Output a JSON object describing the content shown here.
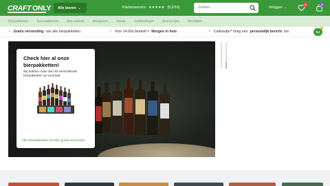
{
  "header": {
    "logo_part1": "CRAFT",
    "logo_part2": "ONLY",
    "menu_button": "Alle bieren",
    "customer_service": "Klantenservice",
    "stars": "★★★★★",
    "rating": "(9,2/10)",
    "search_placeholder": "Zoeken...",
    "login": "Inloggen",
    "wishlist_count": "0",
    "cart_count": "0"
  },
  "categories": [
    "Bierpakketten",
    "Speciaalbieren",
    "Bier cadeau",
    "Bierglazen",
    "Nieuw",
    "Aanbiedingen",
    "Brouwerijen",
    "Bierstijlen"
  ],
  "usp": {
    "item1_bold": "Gratis verzending",
    "item1_text": "van alle bierpakketten",
    "item2_text": "Voor 14:00u besteld =",
    "item2_bold": "Morgen in huis",
    "item3_text": "Cadeautje? Voeg een",
    "item3_bold": "persoonlijk bericht",
    "item3_tail": "toe",
    "rating_badge": "9,2"
  },
  "promo": {
    "title": "Check hier al onze bierpakketten!",
    "subtitle": "Wij hebben meer dan 50 verschillende bierpakketten op voorraad",
    "link": "Alle bierpakketten worden gratis verzonden"
  },
  "colors": {
    "brand_green": "#3a9a3a",
    "badge_red": "#e04a5a",
    "badge_purple": "#8e5bb5"
  }
}
